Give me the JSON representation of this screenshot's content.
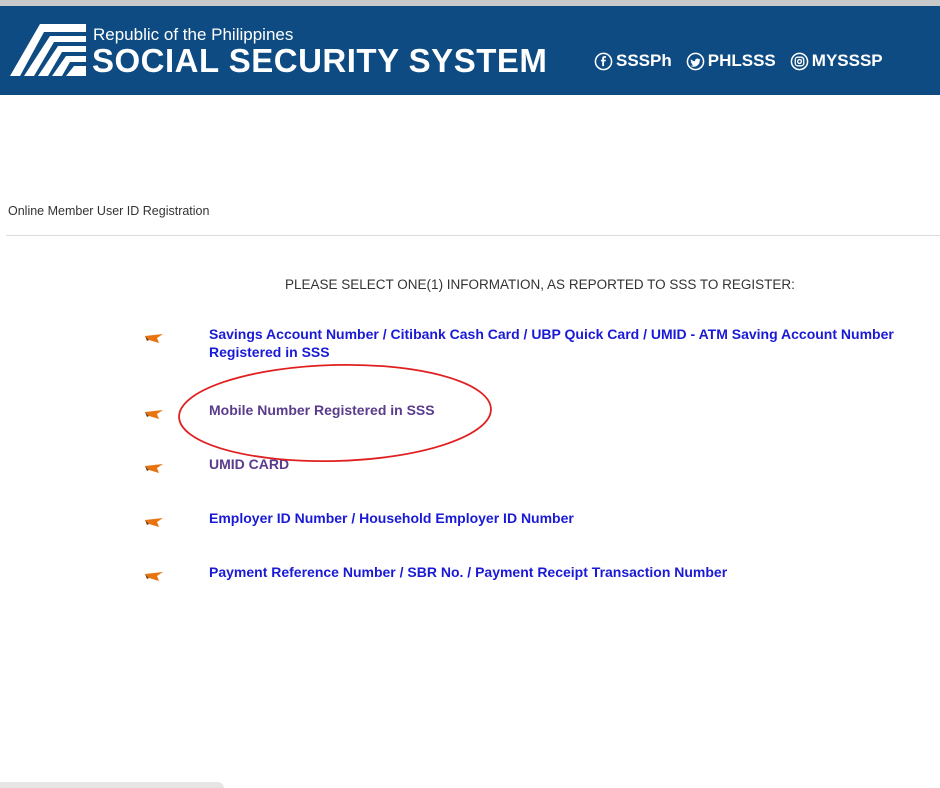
{
  "header": {
    "subtitle": "Republic of the Philippines",
    "title": "SOCIAL SECURITY SYSTEM",
    "socials": [
      {
        "label": "SSSPh",
        "icon": "facebook-icon"
      },
      {
        "label": "PHLSSS",
        "icon": "twitter-icon"
      },
      {
        "label": "MYSSSP",
        "icon": "instagram-icon"
      }
    ]
  },
  "breadcrumb": "Online Member User ID Registration",
  "instruction": "PLEASE SELECT ONE(1) INFORMATION, AS REPORTED TO SSS TO REGISTER:",
  "options": [
    {
      "label": "Savings Account Number / Citibank Cash Card / UBP Quick Card / UMID - ATM Saving Account Number Registered in SSS"
    },
    {
      "label": "Mobile Number Registered in SSS"
    },
    {
      "label": "UMID CARD"
    },
    {
      "label": "Employer ID Number / Household Employer ID Number"
    },
    {
      "label": "Payment Reference Number / SBR No. / Payment Receipt Transaction Number"
    }
  ],
  "colors": {
    "header_bg": "#0e4b82",
    "link": "#1a1ad6",
    "visited_link": "#5a3b8c",
    "annotation": "#e02020",
    "pointer": "#e8740f"
  }
}
